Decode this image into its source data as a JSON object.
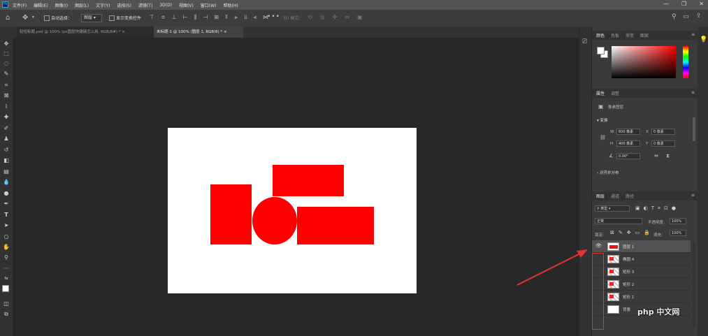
{
  "menubar": {
    "logo": "Ps",
    "items": [
      "文件(F)",
      "编辑(E)",
      "图像(I)",
      "图层(L)",
      "文字(Y)",
      "选择(S)",
      "滤镜(T)",
      "3D(D)",
      "视图(V)",
      "窗口(W)",
      "帮助(H)"
    ],
    "window_controls": [
      "—",
      "❐",
      "✕"
    ]
  },
  "options": {
    "auto_select_label": "自动选择：",
    "auto_select_value": "图层",
    "show_transform_label": "显示变换控件",
    "mode_3d_label": "3D 模式："
  },
  "doc_tabs": [
    {
      "label": "轻短标题.psd @ 100% (ps图层快捷键怎么用, RGB/8#) *",
      "active": false
    },
    {
      "label": "未标题-1 @ 100% (图层 1, RGB/8) *",
      "active": true
    }
  ],
  "panels": {
    "color": {
      "tabs": [
        "颜色",
        "色板",
        "渐变",
        "图案"
      ]
    },
    "properties": {
      "tabs": [
        "属性",
        "调整"
      ],
      "type_label": "像素图层",
      "transform_label": "变换",
      "w_label": "W",
      "w_value": "600 像素",
      "h_label": "H",
      "h_value": "400 像素",
      "x_label": "X",
      "x_value": "0 像素",
      "y_label": "Y",
      "y_value": "0 像素",
      "angle_value": "0.00°",
      "align_label": "对齐并分布"
    },
    "layers": {
      "tabs": [
        "图层",
        "通道",
        "路径"
      ],
      "filter_value": "类型",
      "blend_mode": "正常",
      "opacity_label": "不透明度:",
      "opacity_value": "100%",
      "lock_label": "锁定:",
      "fill_label": "填充:",
      "fill_value": "100%",
      "items": [
        {
          "name": "图层 1",
          "selected": true,
          "visible": true
        },
        {
          "name": "椭圆 4",
          "selected": false,
          "visible": false
        },
        {
          "name": "矩形 3",
          "selected": false,
          "visible": false
        },
        {
          "name": "矩形 2",
          "selected": false,
          "visible": false
        },
        {
          "name": "矩形 1",
          "selected": false,
          "visible": false
        },
        {
          "name": "背景",
          "selected": false,
          "visible": false
        }
      ]
    }
  },
  "watermark": "php 中文网",
  "colors": {
    "accent": "#31a8ff",
    "shape_red": "#fe0000",
    "annotation": "#e53333"
  }
}
